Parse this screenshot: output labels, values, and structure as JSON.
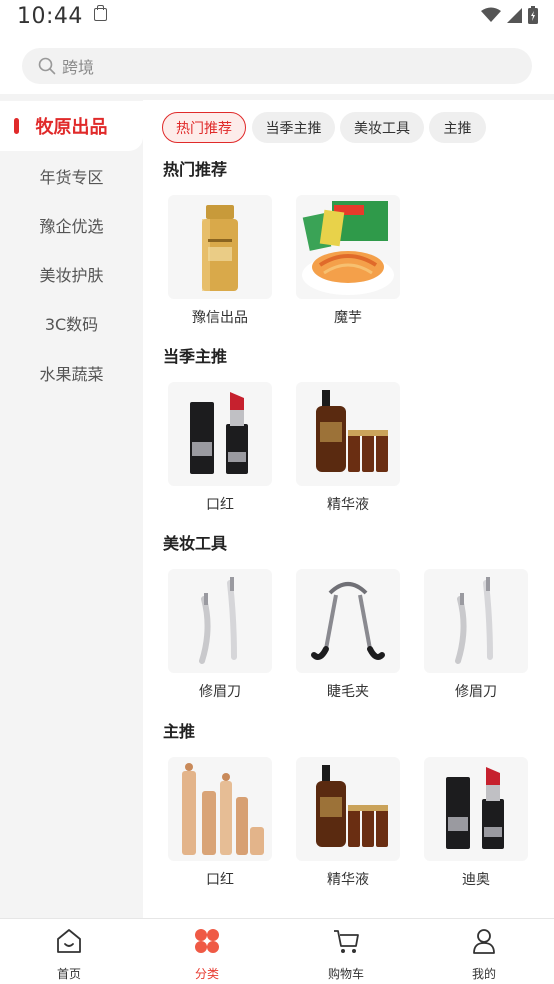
{
  "status_bar": {
    "time": "10:44"
  },
  "search": {
    "placeholder": "跨境"
  },
  "sidebar": {
    "items": [
      {
        "label": "牧原出品",
        "active": true
      },
      {
        "label": "年货专区"
      },
      {
        "label": "豫企优选"
      },
      {
        "label": "美妆护肤"
      },
      {
        "label": "3C数码"
      },
      {
        "label": "水果蔬菜"
      }
    ]
  },
  "chips": [
    {
      "label": "热门推荐",
      "active": true
    },
    {
      "label": "当季主推"
    },
    {
      "label": "美妆工具"
    },
    {
      "label": "主推"
    }
  ],
  "sections": [
    {
      "title": "热门推荐",
      "products": [
        {
          "name": "豫信出品",
          "icon": "sunscreen-bottle"
        },
        {
          "name": "魔芋",
          "icon": "konjac-snack"
        }
      ]
    },
    {
      "title": "当季主推",
      "products": [
        {
          "name": "口红",
          "icon": "lipstick"
        },
        {
          "name": "精华液",
          "icon": "serum-bottles"
        }
      ]
    },
    {
      "title": "美妆工具",
      "products": [
        {
          "name": "修眉刀",
          "icon": "eyebrow-razor"
        },
        {
          "name": "睫毛夹",
          "icon": "eyelash-curler"
        },
        {
          "name": "修眉刀",
          "icon": "eyebrow-razor"
        }
      ]
    },
    {
      "title": "主推",
      "products": [
        {
          "name": "口红",
          "icon": "gold-lipstick-set"
        },
        {
          "name": "精华液",
          "icon": "serum-bottles"
        },
        {
          "name": "迪奥",
          "icon": "lipstick"
        }
      ]
    }
  ],
  "bottom_nav": [
    {
      "label": "首页",
      "icon": "home-icon"
    },
    {
      "label": "分类",
      "icon": "category-icon",
      "active": true
    },
    {
      "label": "购物车",
      "icon": "cart-icon"
    },
    {
      "label": "我的",
      "icon": "profile-icon"
    }
  ],
  "colors": {
    "accent": "#e02a2a",
    "sidebar_bg": "#f4f4f4"
  }
}
